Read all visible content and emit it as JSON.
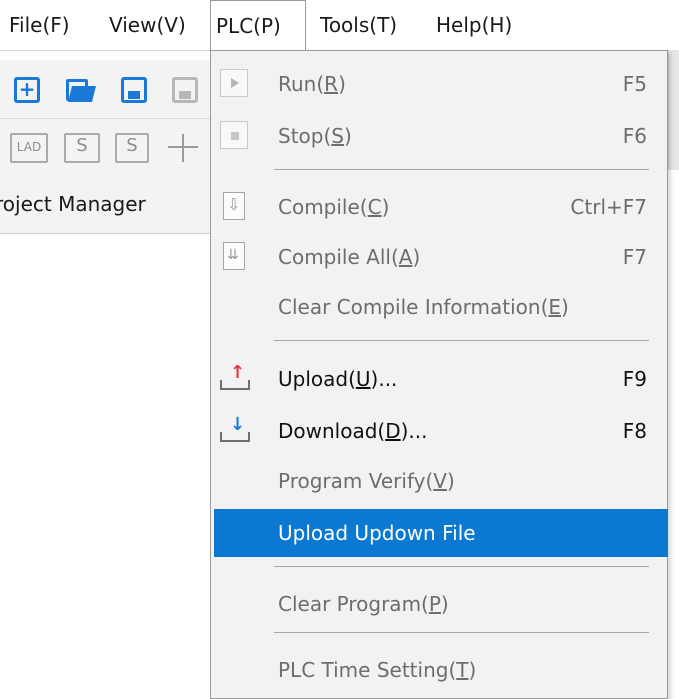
{
  "menubar": {
    "items": [
      {
        "label": "File(F)"
      },
      {
        "label": "View(V)"
      },
      {
        "label": "PLC(P)"
      },
      {
        "label": "Tools(T)"
      },
      {
        "label": "Help(H)"
      }
    ]
  },
  "toolbar": {
    "row1_icons": [
      "new-file-icon",
      "open-folder-icon",
      "save-icon",
      "save-all-icon"
    ],
    "row2": {
      "lad_label": "LAD",
      "s_label_1": "S",
      "s_label_2": "S"
    }
  },
  "project_pane": {
    "title": "Project Manager",
    "visible_title": "roject Manager"
  },
  "plc_menu": {
    "items": [
      {
        "label": "Run(",
        "mnemonic": "R",
        "suffix": ")",
        "shortcut": "F5",
        "enabled": false,
        "icon": "run-icon"
      },
      {
        "label": "Stop(",
        "mnemonic": "S",
        "suffix": ")",
        "shortcut": "F6",
        "enabled": false,
        "icon": "stop-icon"
      },
      {
        "label": "Compile(",
        "mnemonic": "C",
        "suffix": ")",
        "shortcut": "Ctrl+F7",
        "enabled": false,
        "icon": "compile-icon"
      },
      {
        "label": "Compile All(",
        "mnemonic": "A",
        "suffix": ")",
        "shortcut": "F7",
        "enabled": false,
        "icon": "compile-all-icon"
      },
      {
        "label": "Clear Compile Information(",
        "mnemonic": "E",
        "suffix": ")",
        "shortcut": "",
        "enabled": false
      },
      {
        "label": "Upload(",
        "mnemonic": "U",
        "suffix": ")...",
        "shortcut": "F9",
        "enabled": true,
        "icon": "upload-icon"
      },
      {
        "label": "Download(",
        "mnemonic": "D",
        "suffix": ")...",
        "shortcut": "F8",
        "enabled": true,
        "icon": "download-icon"
      },
      {
        "label": "Program Verify(",
        "mnemonic": "V",
        "suffix": ")",
        "shortcut": "",
        "enabled": false
      },
      {
        "label": "Upload Updown File",
        "mnemonic": "",
        "suffix": "",
        "shortcut": "",
        "enabled": true,
        "highlighted": true
      },
      {
        "label": "Clear Program(",
        "mnemonic": "P",
        "suffix": ")",
        "shortcut": "",
        "enabled": false
      },
      {
        "label": "PLC Time Setting(",
        "mnemonic": "T",
        "suffix": ")",
        "shortcut": "",
        "enabled": false
      }
    ]
  },
  "colors": {
    "highlight": "#0b79d2",
    "accent_icon": "#1a78d6",
    "disabled_text": "#6d6d6d"
  }
}
